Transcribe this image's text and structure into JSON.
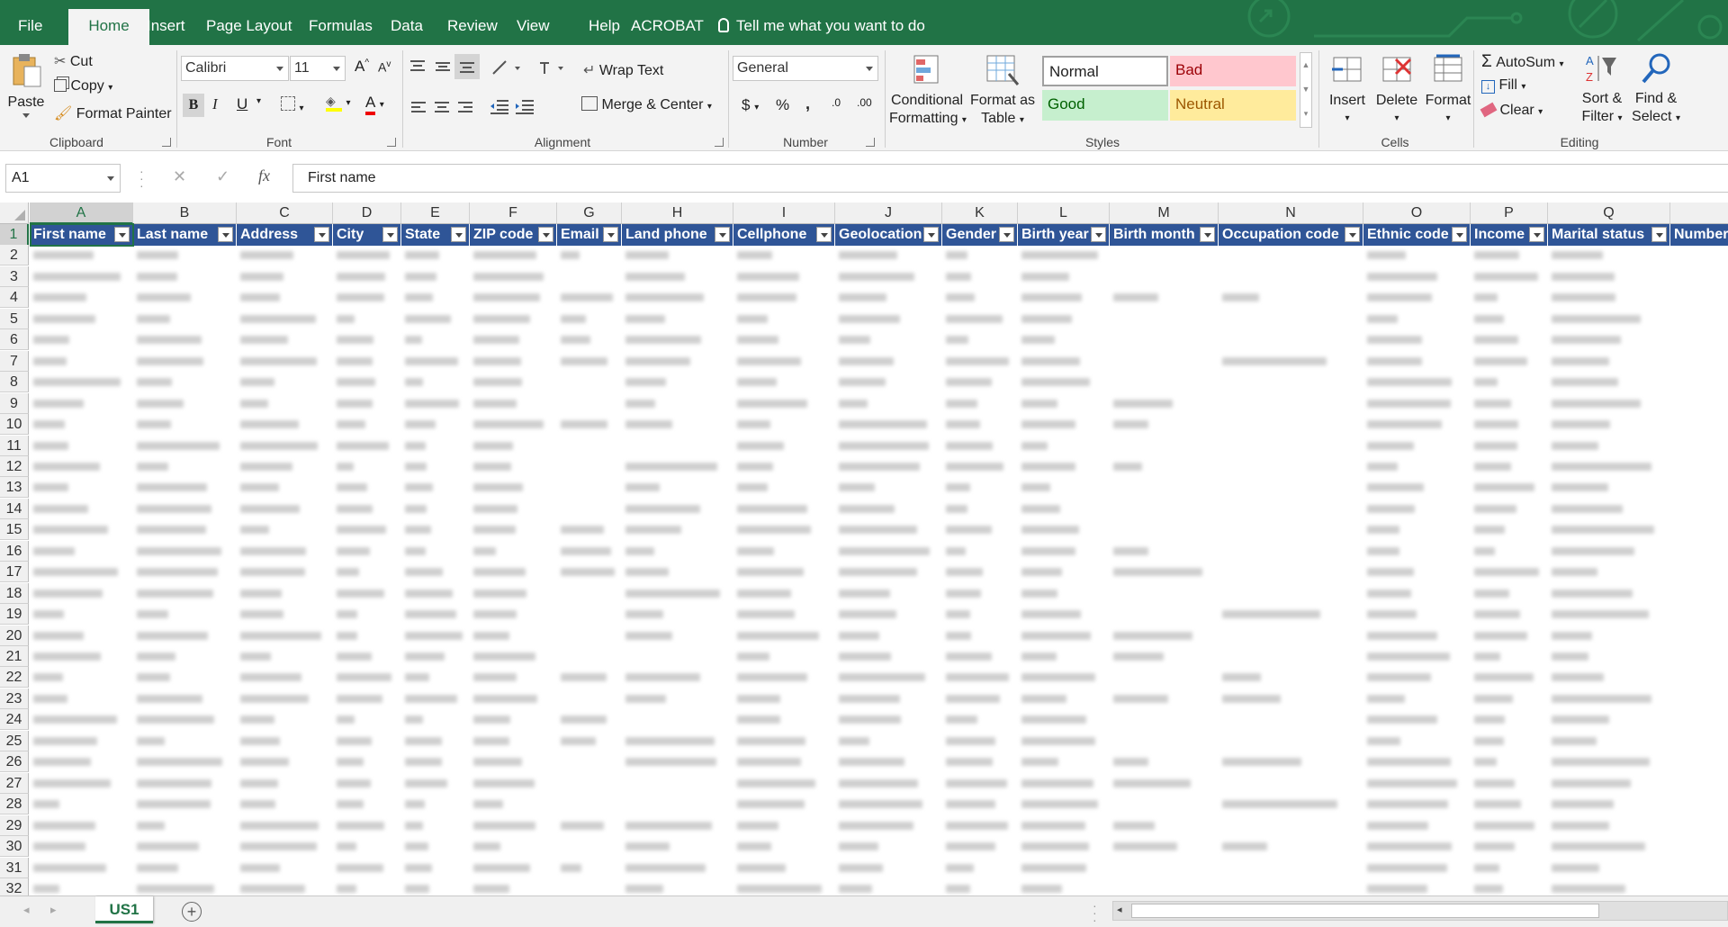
{
  "tabs": [
    {
      "label": "File",
      "active": false
    },
    {
      "label": "Home",
      "active": true
    },
    {
      "label": "Insert",
      "active": false
    },
    {
      "label": "Page Layout",
      "active": false
    },
    {
      "label": "Formulas",
      "active": false
    },
    {
      "label": "Data",
      "active": false
    },
    {
      "label": "Review",
      "active": false
    },
    {
      "label": "View",
      "active": false
    },
    {
      "label": "Help",
      "active": false
    },
    {
      "label": "ACROBAT",
      "active": false
    }
  ],
  "tellme": "Tell me what you want to do",
  "ribbon": {
    "clipboard": {
      "label": "Clipboard",
      "paste": "Paste",
      "cut": "Cut",
      "copy": "Copy",
      "format_painter": "Format Painter"
    },
    "font": {
      "label": "Font",
      "name": "Calibri",
      "size": "11",
      "bold": "B",
      "italic": "I",
      "underline": "U",
      "color_a": "A",
      "grow": "A",
      "shrink": "A"
    },
    "alignment": {
      "label": "Alignment",
      "wrap": "Wrap Text",
      "merge": "Merge & Center"
    },
    "number": {
      "label": "Number",
      "format": "General",
      "currency": "$",
      "percent": "%",
      "comma": ",",
      "inc": ".0",
      "dec": ".00"
    },
    "styles": {
      "label": "Styles",
      "cond_line1": "Conditional",
      "cond_line2": "Formatting",
      "fmt_line1": "Format as",
      "fmt_line2": "Table",
      "normal": "Normal",
      "bad": "Bad",
      "good": "Good",
      "neutral": "Neutral"
    },
    "cells": {
      "label": "Cells",
      "insert": "Insert",
      "delete": "Delete",
      "format": "Format"
    },
    "editing": {
      "label": "Editing",
      "autosum": "AutoSum",
      "fill": "Fill",
      "clear": "Clear",
      "sort_line1": "Sort &",
      "sort_line2": "Filter",
      "find_line1": "Find &",
      "find_line2": "Select"
    }
  },
  "formula_bar": {
    "cell_ref": "A1",
    "content": "First name",
    "x": "✕",
    "check": "✓",
    "fx": "fx"
  },
  "grid": {
    "selected_cell": "A1",
    "columns": [
      {
        "letter": "A",
        "header": "First name",
        "w": 115
      },
      {
        "letter": "B",
        "header": "Last name",
        "w": 115
      },
      {
        "letter": "C",
        "header": "Address",
        "w": 107
      },
      {
        "letter": "D",
        "header": "City",
        "w": 76
      },
      {
        "letter": "E",
        "header": "State",
        "w": 76
      },
      {
        "letter": "F",
        "header": "ZIP code",
        "w": 97
      },
      {
        "letter": "G",
        "header": "Email",
        "w": 72
      },
      {
        "letter": "H",
        "header": "Land phone",
        "w": 124
      },
      {
        "letter": "I",
        "header": "Cellphone",
        "w": 113
      },
      {
        "letter": "J",
        "header": "Geolocation",
        "w": 119
      },
      {
        "letter": "K",
        "header": "Gender",
        "w": 84
      },
      {
        "letter": "L",
        "header": "Birth year",
        "w": 102
      },
      {
        "letter": "M",
        "header": "Birth month",
        "w": 121
      },
      {
        "letter": "N",
        "header": "Occupation code",
        "w": 161
      },
      {
        "letter": "O",
        "header": "Ethnic code",
        "w": 119
      },
      {
        "letter": "P",
        "header": "Income",
        "w": 86
      },
      {
        "letter": "Q",
        "header": "Marital status",
        "w": 136
      },
      {
        "letter": "",
        "header": "Number",
        "w": 91
      }
    ],
    "rows": [
      "1",
      "2",
      "3",
      "4",
      "5",
      "6",
      "7",
      "8",
      "9",
      "10",
      "11",
      "12",
      "13",
      "14",
      "15",
      "16",
      "17",
      "18",
      "19",
      "20",
      "21",
      "22",
      "23",
      "24",
      "25",
      "26",
      "27",
      "28",
      "29",
      "30",
      "31",
      "32"
    ]
  },
  "sheets": [
    {
      "name": "US1",
      "active": true
    }
  ],
  "colors": {
    "excel_green": "#217346",
    "header_blue": "#2f5597",
    "bad_bg": "#ffc7ce",
    "bad_fg": "#9c0006",
    "good_bg": "#c6efce",
    "good_fg": "#006100",
    "neutral_bg": "#ffeb9c",
    "neutral_fg": "#9c5700"
  }
}
